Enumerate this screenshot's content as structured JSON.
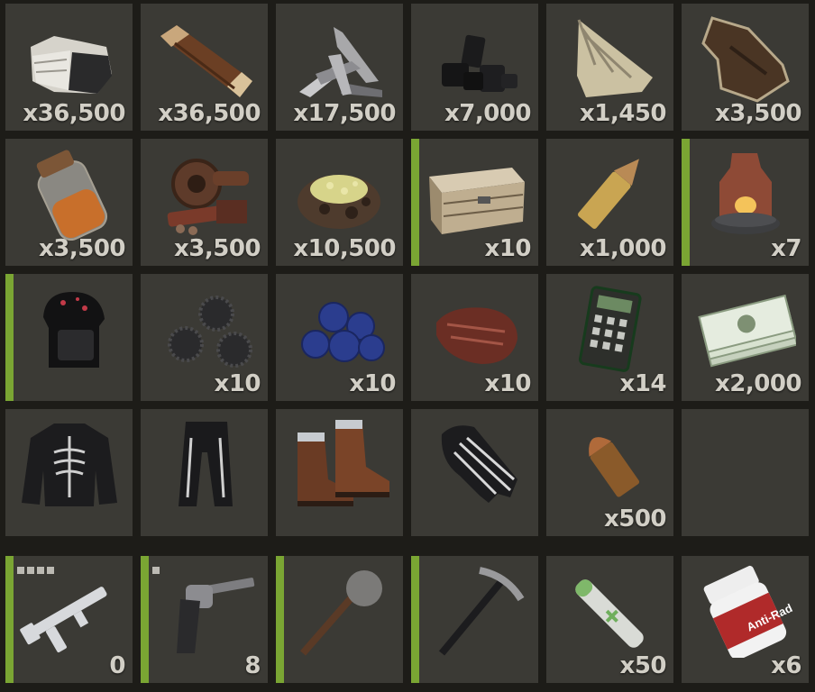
{
  "inventory": [
    {
      "icon": "stones-icon",
      "qty": "x36,500"
    },
    {
      "icon": "wood-icon",
      "qty": "x36,500"
    },
    {
      "icon": "metal-fragments-icon",
      "qty": "x17,500"
    },
    {
      "icon": "charcoal-icon",
      "qty": "x7,000"
    },
    {
      "icon": "cloth-icon",
      "qty": "x1,450"
    },
    {
      "icon": "leather-icon",
      "qty": "x3,500"
    },
    {
      "icon": "low-grade-fuel-icon",
      "qty": "x3,500"
    },
    {
      "icon": "scrap-icon",
      "qty": "x3,500"
    },
    {
      "icon": "sulfur-ore-icon",
      "qty": "x10,500"
    },
    {
      "icon": "wooden-box-icon",
      "qty": "x10",
      "accent": true
    },
    {
      "icon": "rifle-ammo-icon",
      "qty": "x1,000"
    },
    {
      "icon": "furnace-icon",
      "qty": "x7",
      "accent": true
    },
    {
      "icon": "skull-mask-icon",
      "qty": "",
      "accent": true
    },
    {
      "icon": "blackberries-icon",
      "qty": "x10"
    },
    {
      "icon": "blueberries-icon",
      "qty": "x10"
    },
    {
      "icon": "cooked-meat-icon",
      "qty": "x10"
    },
    {
      "icon": "calculator-icon",
      "qty": "x14"
    },
    {
      "icon": "cash-icon",
      "qty": "x2,000"
    },
    {
      "icon": "skeleton-hoodie-icon",
      "qty": ""
    },
    {
      "icon": "skeleton-pants-icon",
      "qty": ""
    },
    {
      "icon": "boots-icon",
      "qty": ""
    },
    {
      "icon": "skeleton-gloves-icon",
      "qty": ""
    },
    {
      "icon": "pistol-ammo-icon",
      "qty": "x500"
    },
    {
      "icon": "empty-slot",
      "qty": ""
    }
  ],
  "hotbar": [
    {
      "icon": "assault-rifle-icon",
      "qty": "0",
      "accent": true,
      "dots": 4
    },
    {
      "icon": "revolver-icon",
      "qty": "8",
      "accent": true,
      "dots": 1
    },
    {
      "icon": "stone-hatchet-icon",
      "qty": "",
      "accent": true
    },
    {
      "icon": "pickaxe-icon",
      "qty": "",
      "accent": true
    },
    {
      "icon": "syringe-icon",
      "qty": "x50"
    },
    {
      "icon": "anti-rad-pills-icon",
      "qty": "x6"
    }
  ],
  "colors": {
    "slot": "#3b3a35",
    "background": "#1d1c18",
    "accent": "#7aa533",
    "text": "#d2cfc6"
  },
  "bottle_label": "Anti-Rad"
}
